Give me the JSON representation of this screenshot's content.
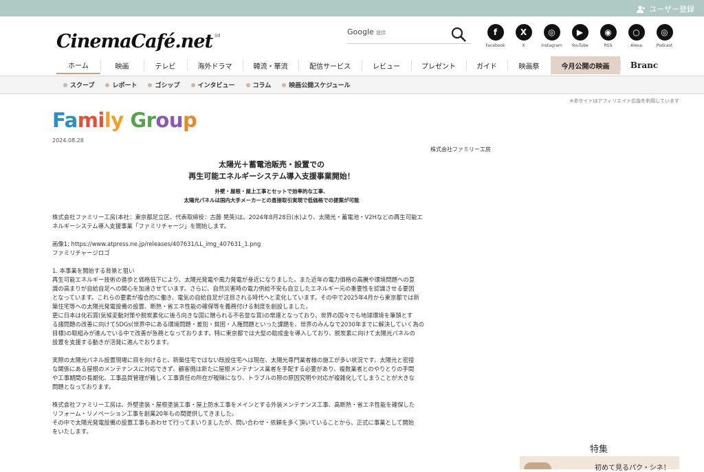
{
  "header": {
    "user_register": "ユーザー登録",
    "logo_text": "CinemaCafé.net",
    "logo_sub": "iid",
    "search_brand": "Google",
    "search_provided": "提供",
    "socials": [
      {
        "label": "Facebook",
        "glyph": "f"
      },
      {
        "label": "X",
        "glyph": "X"
      },
      {
        "label": "Instagram",
        "glyph": "◎"
      },
      {
        "label": "YouTube",
        "glyph": "▶"
      },
      {
        "label": "RSS",
        "glyph": "◉"
      },
      {
        "label": "Alexa",
        "glyph": "○"
      },
      {
        "label": "Podcast",
        "glyph": "◎"
      }
    ]
  },
  "nav": {
    "items": [
      "ホーム",
      "映画",
      "テレビ",
      "海外ドラマ",
      "韓流・華流",
      "配信サービス",
      "レビュー",
      "プレゼント",
      "ガイド",
      "映画祭",
      "今月公開の映画",
      "Branc"
    ]
  },
  "subnav": {
    "items": [
      "スクープ",
      "レポート",
      "ゴシップ",
      "インタビュー",
      "コラム",
      "映画公開スケジュール"
    ]
  },
  "notice": "※本サイトはアフィリエイト広告を利用しています",
  "article": {
    "brand_logo": [
      "Fa",
      "mi",
      "ly ",
      "Gr",
      "ou",
      "p"
    ],
    "date": "2024.08.28",
    "company": "株式会社ファミリー工房",
    "headline1": "太陽光＋蓄電池販売・設置での",
    "headline2": "再生可能エネルギーシステム導入支援事業開始！",
    "subhead1": "外壁・屋根・屋上工事とセットで効率的な工事、",
    "subhead2": "太陽光パネルは国内大手メーカーとの直接取引実現で低価格での提案が可能",
    "p1_l1": "株式会社ファミリー工房(本社：東京都足立区、代表取締役：古藤 晃英)は、2024年8月28日(水)より、太陽光・蓄電池・V2Hなどの再生可能エ",
    "p1_l2": "ネルギーシステム導入支援事業「ファミリチャージ」を開始します。",
    "img_line": "画像1: https://www.atpress.ne.jp/releases/407631/LL_img_407631_1.png",
    "img_caption": "ファミリチャージロゴ",
    "s1_title": "1. 本事業を開始する背景と狙い",
    "s1_l1": "再生可能エネルギー技術の進歩と価格低下により、太陽光発電や風力発電が身近になりました。また近年の電力価格の高騰や環境問題への意",
    "s1_l2": "識の高まりが自給自足への関心を加速させています。さらに、自然災害時の電力供給不安も自立したエネルギー元の重要性を認識させる要因",
    "s1_l3": "となっています。これらの要素が複合的に働き、電気の自給自足が注目される時代へと変化しています。その中で2025年4月から東京都では新",
    "s1_l4": "築住宅等への太陽光発電設備の設置、断熱・省エネ性能の確保等を義務付ける制度を創設しました。",
    "s1_l5": "更に日本は化石賞(気候変動対策や脱炭素化に後ろ向きな国に贈られる不名誉な賞)の常連となっており、世界の国々でも地球環境を筆頭とす",
    "s1_l6": "る諸問題の改善に向けてSDGs(世界中にある環境問題・差別・貧困・人権問題といった課題を、世界のみんなで2030年までに解決していく為の",
    "s1_l7": "目標)の取組みが進んでいる中で改善が急務となっております。特に東京都では大型の助成金を導入しており、脱炭素に向けて太陽光パネルの",
    "s1_l8": "設置を支援する動きが活発に進んでおります。",
    "p3_l1": "実際の太陽光パネル設置現場に目を向けると、新築住宅ではない既設住宅へは現在、太陽光専門業者様の施工が多い状況です。太陽光と密接",
    "p3_l2": "な関係にある屋根のメンテナンスに対応できず、顧客側は新たに屋根メンテナンス業者を手配する必要があり、複数業者とのやりとりの手間",
    "p3_l3": "や工事期間の長期化、工事品質管理が難しく工事責任の所在が曖昧になり、トラブルの際の原因究明や対応が複雑化してしまうことが大きな",
    "p3_l4": "問題となっております。",
    "p4_l1": "株式会社ファミリー工房は、外壁塗装・屋根塗装工事・屋上防水工事をメインとする外装メンテナンス工事、高断熱・省エネ性能を確保した",
    "p4_l2": "リフォーム・リノベーション工事を創業20年もの間提供してきました。",
    "p4_l3": "その中で太陽光発電設備の設置工事もあわせて行ってまいりましたが、問い合わせ・依頼を多く頂いていることから、正式に事業として開始",
    "p4_l4": "をいたします。"
  },
  "sidebar": {
    "title": "特集",
    "feature_text": "初めて見るパク・シネ！"
  }
}
